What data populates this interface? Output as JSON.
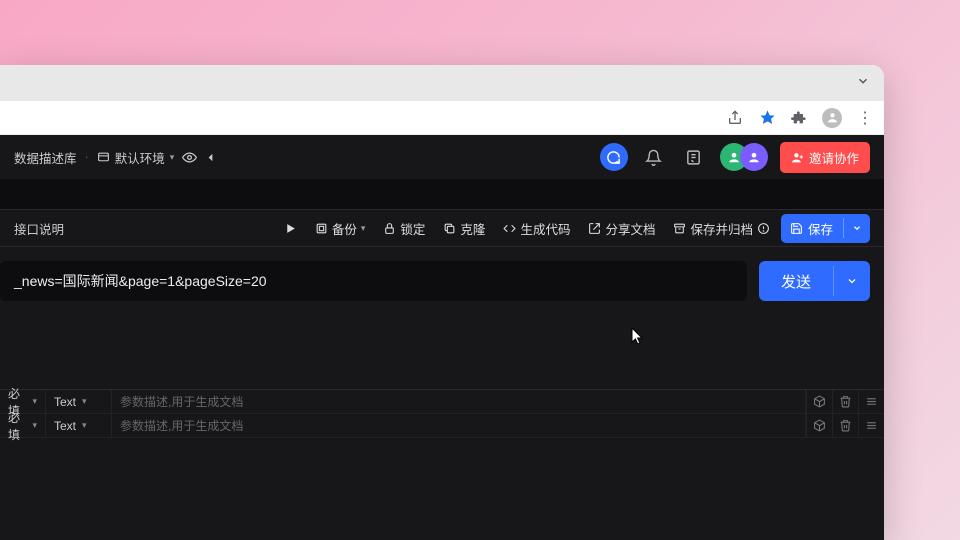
{
  "chrome": {
    "star_filled": true
  },
  "topbar": {
    "left_items": [
      "数据描述库",
      "默认环境"
    ],
    "invite_label": "邀请协作"
  },
  "actions": {
    "left_tab": "接口说明",
    "backup": "备份",
    "lock": "锁定",
    "clone": "克隆",
    "gen_code": "生成代码",
    "share_doc": "分享文档",
    "archive": "保存并归档",
    "save": "保存"
  },
  "request": {
    "url_fragment": "_news=国际新闻&page=1&pageSize=20",
    "send_label": "发送"
  },
  "params": {
    "rows": [
      {
        "required": "必填",
        "type": "Text",
        "placeholder": "参数描述,用于生成文档"
      },
      {
        "required": "必填",
        "type": "Text",
        "placeholder": "参数描述,用于生成文档"
      }
    ]
  }
}
